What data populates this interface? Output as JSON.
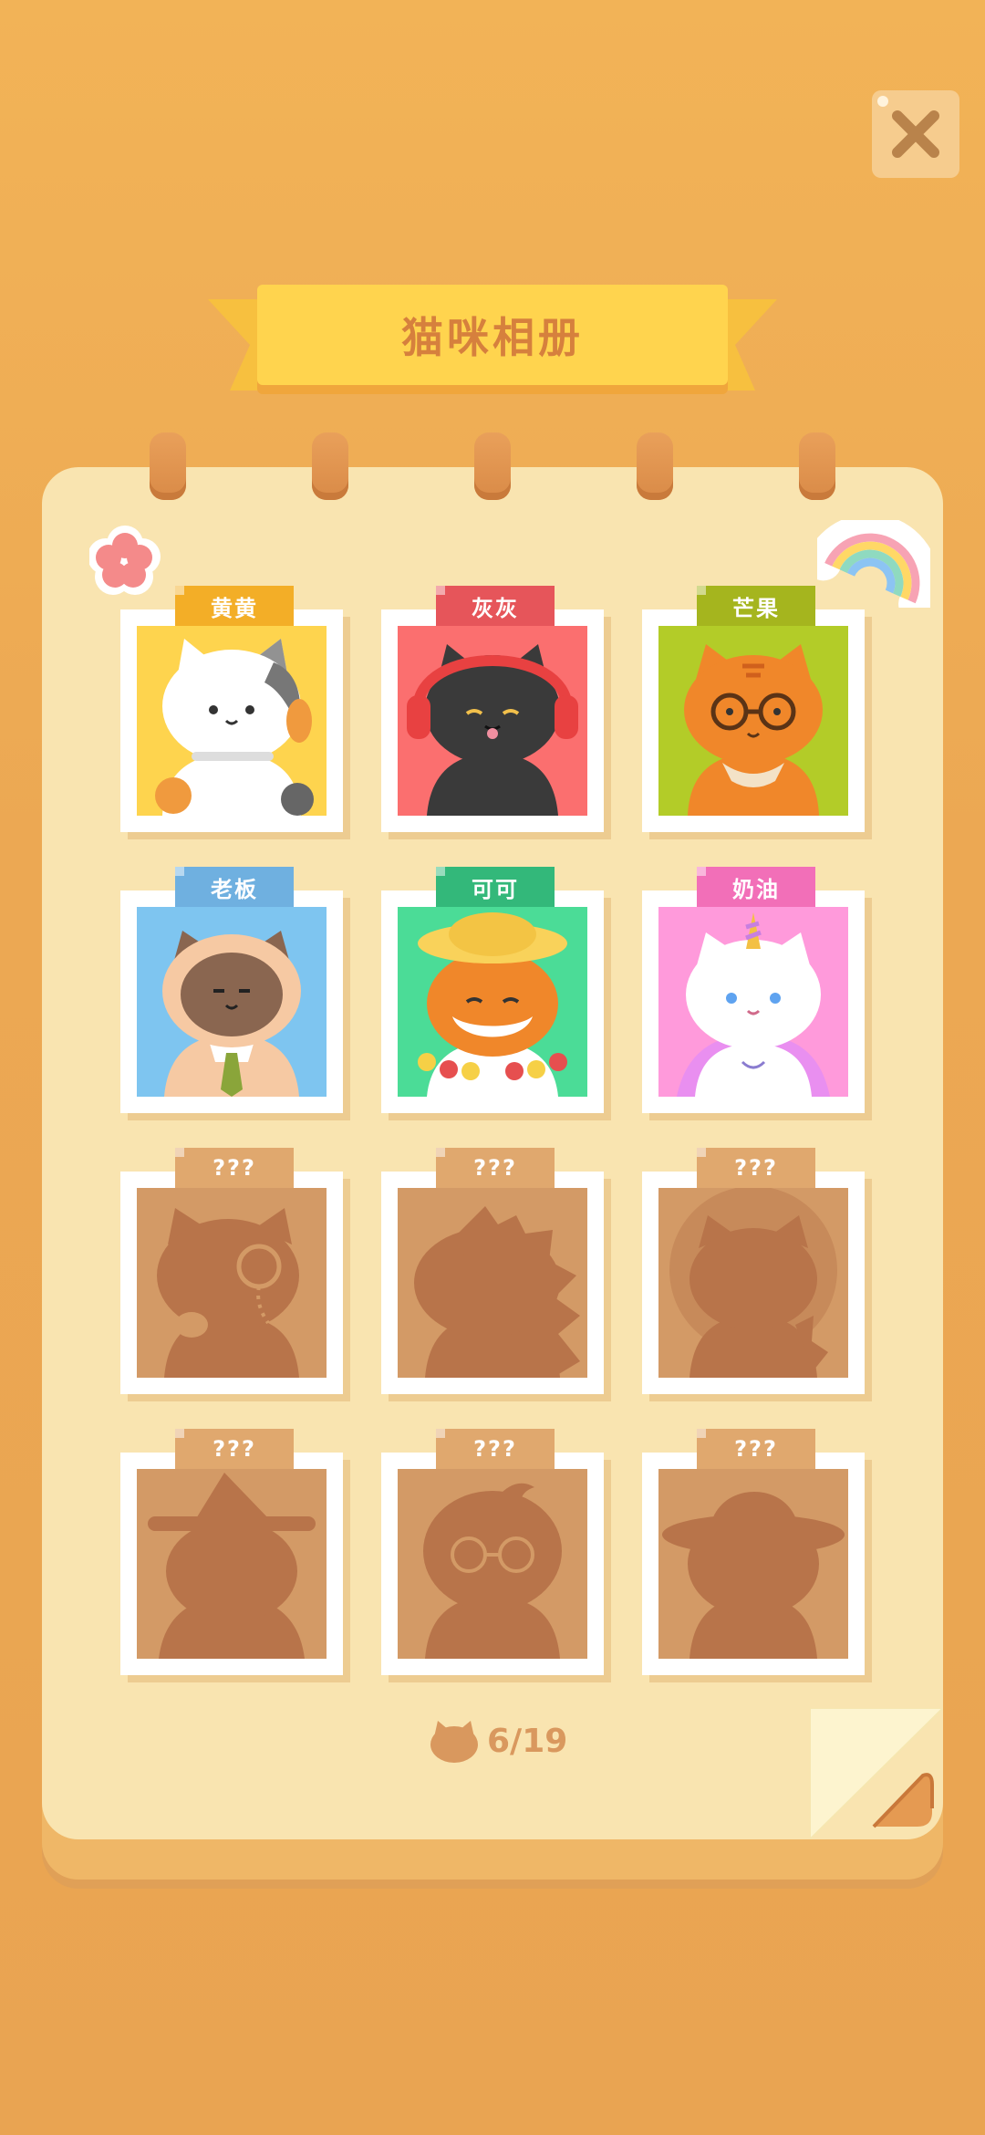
{
  "title": "猫咪相册",
  "close_icon": "close-icon",
  "counter": {
    "text": "6/19",
    "icon": "cat-head-icon"
  },
  "colors": {
    "background": "#eca853",
    "album": "#f9e4b0",
    "ribbon": "#ffd44e",
    "title_text": "#d6803d",
    "locked_photo": "#d39a66",
    "silhouette": "#b8744a"
  },
  "cats": [
    {
      "name": "黄黄",
      "tag_color": "#f3ae27",
      "bg": "#fed44e",
      "cat": "calico",
      "unlocked": true
    },
    {
      "name": "灰灰",
      "tag_color": "#e6555a",
      "bg": "#fb6f6f",
      "cat": "black-headphones",
      "unlocked": true
    },
    {
      "name": "芒果",
      "tag_color": "#a5b51e",
      "bg": "#b3cc28",
      "cat": "orange-glasses",
      "unlocked": true
    },
    {
      "name": "老板",
      "tag_color": "#6fb0e0",
      "bg": "#7ec5f0",
      "cat": "siamese-tie",
      "unlocked": true
    },
    {
      "name": "可可",
      "tag_color": "#33b87a",
      "bg": "#4bdc97",
      "cat": "orange-straw-hat",
      "unlocked": true
    },
    {
      "name": "奶油",
      "tag_color": "#f26fb8",
      "bg": "#ff9adb",
      "cat": "white-unicorn",
      "unlocked": true
    },
    {
      "name": "???",
      "unlocked": false,
      "cat": "monocle-silhouette"
    },
    {
      "name": "???",
      "unlocked": false,
      "cat": "spiky-silhouette"
    },
    {
      "name": "???",
      "unlocked": false,
      "cat": "round-silhouette"
    },
    {
      "name": "???",
      "unlocked": false,
      "cat": "top-hat-silhouette"
    },
    {
      "name": "???",
      "unlocked": false,
      "cat": "glasses-silhouette"
    },
    {
      "name": "???",
      "unlocked": false,
      "cat": "wide-hat-silhouette"
    }
  ]
}
